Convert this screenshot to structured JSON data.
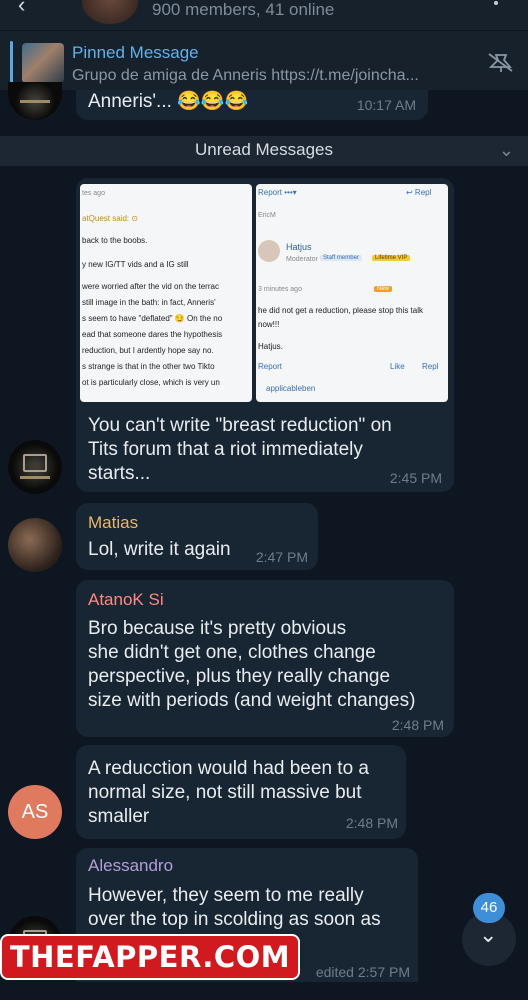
{
  "header": {
    "members_online": "900 members, 41 online"
  },
  "pinned": {
    "title": "Pinned Message",
    "subtitle": "Grupo de amiga de Anneris  https://t.me/joincha..."
  },
  "messages": {
    "partial_top": {
      "text": "Anneris'... 😂😂😂",
      "time": "10:17 AM"
    },
    "unread_label": "Unread Messages",
    "m1": {
      "text": "You can't write \"breast reduction\" on\nTits forum that a riot immediately\nstarts...",
      "time": "2:45 PM"
    },
    "m2": {
      "name": "Matias",
      "text": "Lol, write it again",
      "time": "2:47 PM"
    },
    "m3": {
      "name": "AtanoK Si",
      "text": "Bro because it's pretty obvious\nshe didn't get one, clothes change\nperspective, plus they really change\nsize with periods (and weight changes)",
      "time": "2:48 PM"
    },
    "m4": {
      "initials": "AS",
      "text": "A reducction would had been to a\nnormal size, not still massive but\nsmaller",
      "time": "2:48 PM"
    },
    "m5": {
      "name": "Alessandro",
      "text": "However, they seem to me really\nover the top in scolding as soon as\n                         d that they",
      "time": "edited 2:57 PM"
    }
  },
  "screenshot_left": {
    "l1": "tes ago",
    "l2": "atQuest said: ⊙",
    "l3": "back to the boobs.",
    "l4": "y new IG/TT vids and a IG still",
    "l5": "were worried after the vid on the terrac",
    "l6": "still image in the bath: in fact, Anneris'",
    "l7": "s seem to have \"deflated\" 😏 On the no",
    "l8": "ead that someone dares the hypothesis",
    "l9": "reduction, but I ardently hope say no.",
    "l10": "s strange is that in the other two Tikto",
    "l11": "ot is particularly close, which is very un"
  },
  "screenshot_right": {
    "report": "Report  •••▾",
    "reply": "↩ Repl",
    "user_small": "EricM",
    "user": "Hatjus",
    "role": "Moderator",
    "staff": "Staff member",
    "vip": "Lifetime VIP",
    "mins": "3 minutes ago",
    "new": "New",
    "line1": "he did not get a reduction, please stop this talk",
    "line2": "now!!!",
    "line3": "Hatjus.",
    "report2": "Report",
    "like": "Like",
    "reply2": "Repl",
    "liker": "applicableben"
  },
  "fab": {
    "badge": "46"
  },
  "watermark": "THEFAPPER.COM",
  "colors": {
    "background": "#0e1621",
    "bubble": "#182533",
    "accent": "#63b1ea",
    "name_matias": "#e8b86a",
    "name_atanok": "#ff8a80",
    "name_alessandro": "#b39ddb"
  }
}
